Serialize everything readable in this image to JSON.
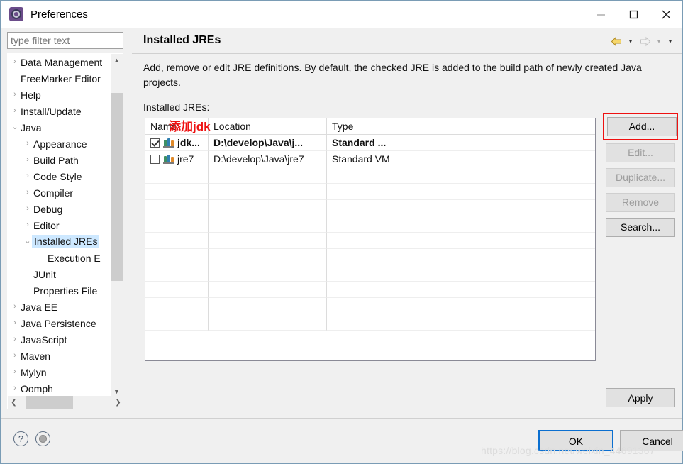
{
  "window": {
    "title": "Preferences",
    "icon": "gear-icon",
    "controls": {
      "minimize": "minimize-icon",
      "maximize": "maximize-icon",
      "close": "close-icon"
    }
  },
  "sidebar": {
    "filter": {
      "placeholder": "type filter text",
      "value": ""
    },
    "items": [
      {
        "label": "Data Management",
        "level": 1,
        "twisty": "›"
      },
      {
        "label": "FreeMarker Editor",
        "level": 1,
        "twisty": ""
      },
      {
        "label": "Help",
        "level": 1,
        "twisty": "›"
      },
      {
        "label": "Install/Update",
        "level": 1,
        "twisty": "›"
      },
      {
        "label": "Java",
        "level": 1,
        "twisty": "⌄"
      },
      {
        "label": "Appearance",
        "level": 2,
        "twisty": "›"
      },
      {
        "label": "Build Path",
        "level": 2,
        "twisty": "›"
      },
      {
        "label": "Code Style",
        "level": 2,
        "twisty": "›"
      },
      {
        "label": "Compiler",
        "level": 2,
        "twisty": "›"
      },
      {
        "label": "Debug",
        "level": 2,
        "twisty": "›"
      },
      {
        "label": "Editor",
        "level": 2,
        "twisty": "›"
      },
      {
        "label": "Installed JREs",
        "level": 2,
        "twisty": "⌄",
        "selected": true
      },
      {
        "label": "Execution E",
        "level": 3,
        "twisty": ""
      },
      {
        "label": "JUnit",
        "level": 2,
        "twisty": ""
      },
      {
        "label": "Properties File",
        "level": 2,
        "twisty": ""
      },
      {
        "label": "Java EE",
        "level": 1,
        "twisty": "›"
      },
      {
        "label": "Java Persistence",
        "level": 1,
        "twisty": "›"
      },
      {
        "label": "JavaScript",
        "level": 1,
        "twisty": "›"
      },
      {
        "label": "Maven",
        "level": 1,
        "twisty": "›"
      },
      {
        "label": "Mylyn",
        "level": 1,
        "twisty": "›"
      },
      {
        "label": "Oomph",
        "level": 1,
        "twisty": "›"
      }
    ]
  },
  "page": {
    "title": "Installed JREs",
    "description": "Add, remove or edit JRE definitions. By default, the checked JRE is added to the build path of newly created Java projects.",
    "table_label": "Installed JREs:",
    "nav": {
      "back": "back-arrow-icon",
      "back_caret": "▾",
      "forward": "forward-arrow-icon",
      "forward_caret": "▾",
      "menu_caret": "▾"
    }
  },
  "table": {
    "columns": [
      "Name",
      "Location",
      "Type"
    ],
    "rows": [
      {
        "checked": true,
        "name": "jdk...",
        "location": "D:\\develop\\Java\\j...",
        "type": "Standard ...",
        "bold": true
      },
      {
        "checked": false,
        "name": "jre7",
        "location": "D:\\develop\\Java\\jre7",
        "type": "Standard VM",
        "bold": false
      }
    ],
    "empty_row_count": 10
  },
  "annotation": {
    "text": "添加jdk",
    "color": "#ee1111"
  },
  "buttons": {
    "add": {
      "label": "Add...",
      "enabled": true,
      "highlighted": true
    },
    "edit": {
      "label": "Edit...",
      "enabled": false
    },
    "duplicate": {
      "label": "Duplicate...",
      "enabled": false
    },
    "remove": {
      "label": "Remove",
      "enabled": false
    },
    "search": {
      "label": "Search...",
      "enabled": true
    },
    "apply": {
      "label": "Apply",
      "enabled": true
    },
    "ok": {
      "label": "OK",
      "enabled": true,
      "focused": true
    },
    "cancel": {
      "label": "Cancel",
      "enabled": true
    }
  },
  "footer": {
    "help_icon": "?",
    "shell_icon": "shell-icon"
  },
  "watermark": "https://blog.csdn.net/weixin_44691367",
  "colors": {
    "accent": "#0b6fd0",
    "annotation": "#ee1111",
    "selection": "#cde8ff",
    "panel": "#f0f0f0"
  }
}
